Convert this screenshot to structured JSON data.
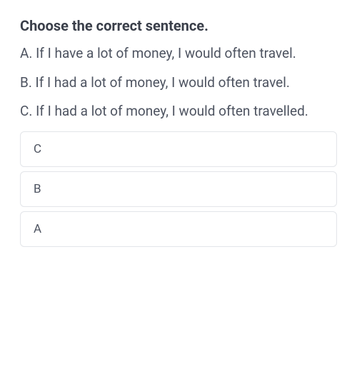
{
  "question": {
    "title": "Choose the correct sentence.",
    "options": [
      "A. If I have a lot of money, I would often travel.",
      "B. If I had a lot of money, I would often travel.",
      "C. If I had a lot of money, I would often travelled."
    ]
  },
  "answers": [
    {
      "label": "C"
    },
    {
      "label": "B"
    },
    {
      "label": "A"
    }
  ]
}
